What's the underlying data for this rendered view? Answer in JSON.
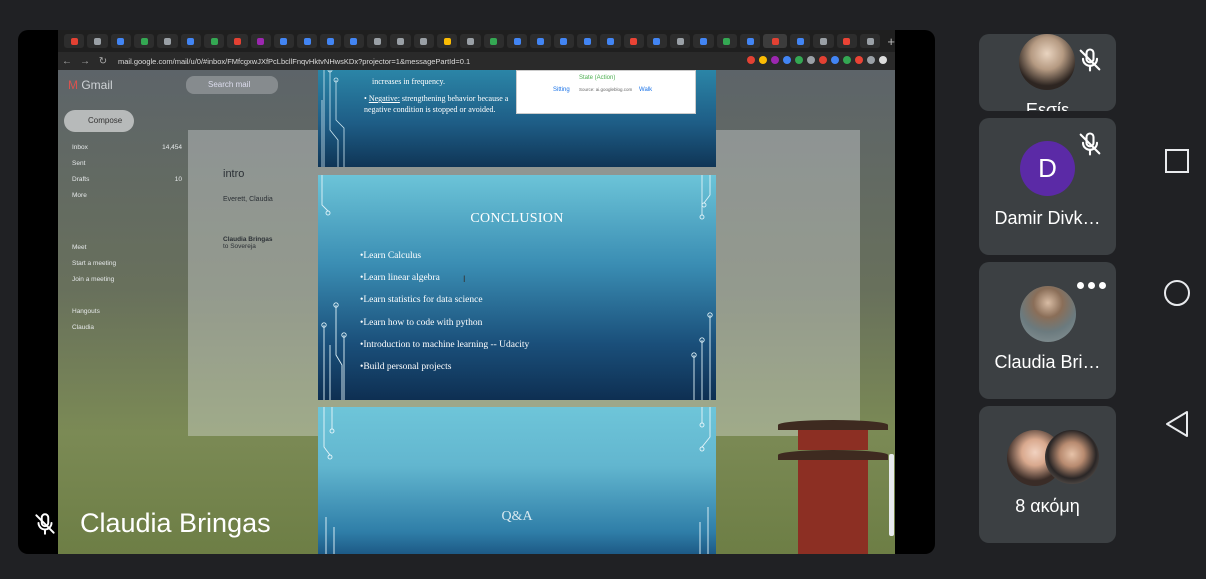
{
  "browser": {
    "url": "mail.google.com/mail/u/0/#inbox/FMfcgxwJXfPcLbcllFnqvHktvNHwsKDx?projector=1&messagePartId=0.1",
    "new_tab_glyph": "+",
    "tab_colors": [
      "#e34133",
      "#9aa0a6",
      "#4285f4",
      "#34a853",
      "#9aa0a6",
      "#4285f4",
      "#34a853",
      "#e34133",
      "#9c27b0",
      "#4285f4",
      "#4285f4",
      "#4285f4",
      "#4285f4",
      "#9aa0a6",
      "#9aa0a6",
      "#9aa0a6",
      "#fbbc04",
      "#9aa0a6",
      "#34a853",
      "#4285f4",
      "#4285f4",
      "#4285f4",
      "#4285f4",
      "#4285f4",
      "#ea4335",
      "#4285f4",
      "#9aa0a6",
      "#4285f4",
      "#34a853",
      "#4285f4",
      "#e34133",
      "#4285f4",
      "#9aa0a6",
      "#ea4335",
      "#9aa0a6"
    ]
  },
  "gmail": {
    "logo_text": "Gmail",
    "search_placeholder": "Search mail",
    "compose_label": "Compose",
    "sidebar": [
      {
        "label": "Inbox",
        "count": "14,454"
      },
      {
        "label": "Sent",
        "count": ""
      },
      {
        "label": "Drafts",
        "count": "10"
      },
      {
        "label": "More",
        "count": ""
      },
      {
        "label": "Meet",
        "count": ""
      },
      {
        "label": "Start a meeting",
        "count": ""
      },
      {
        "label": "Join a meeting",
        "count": ""
      },
      {
        "label": "Hangouts",
        "count": ""
      },
      {
        "label": "Claudia",
        "count": ""
      }
    ],
    "subject": "intro",
    "sender_1": "Everett, Claudia",
    "sender_2": "Claudia Bringas",
    "recipient": "to Sovereja"
  },
  "slides": {
    "slide1_bullets": [
      "increases in frequency.",
      "Negative: strengthening behavior because a negative condition is stopped or avoided."
    ],
    "slide1_negative_label": "Negative:",
    "slide1_negative_text": " strengthening behavior because a negative condition is stopped or avoided.",
    "diagram_state": "State (Action)",
    "diagram_sitting": "Sitting",
    "diagram_walk": "Walk",
    "diagram_source": "Source: ai.googleblog.com",
    "conclusion_title": "CONCLUSION",
    "conclusion_items": [
      "•Learn Calculus",
      "•Learn linear algebra",
      "•Learn statistics for data science",
      "•Learn how to code with python",
      "•Introduction to machine learning -- Udacity",
      "•Build personal projects"
    ],
    "qa_title": "Q&A"
  },
  "presenter": {
    "name": "Claudia Bringas",
    "mic_state": "muted"
  },
  "participants": [
    {
      "name": "Eεσίε",
      "mic_state": "muted",
      "avatar": "photo"
    },
    {
      "name": "Damir Divk…",
      "mic_state": "muted",
      "avatar_letter": "D",
      "avatar_color": "#5b2aa6"
    },
    {
      "name": "Claudia Bri…",
      "mic_state": "speaking",
      "avatar": "photo"
    },
    {
      "name": "8 ακόμη",
      "mic_state": "",
      "avatar": "group"
    }
  ],
  "android_nav": [
    "recents-icon",
    "home-icon",
    "back-icon"
  ]
}
